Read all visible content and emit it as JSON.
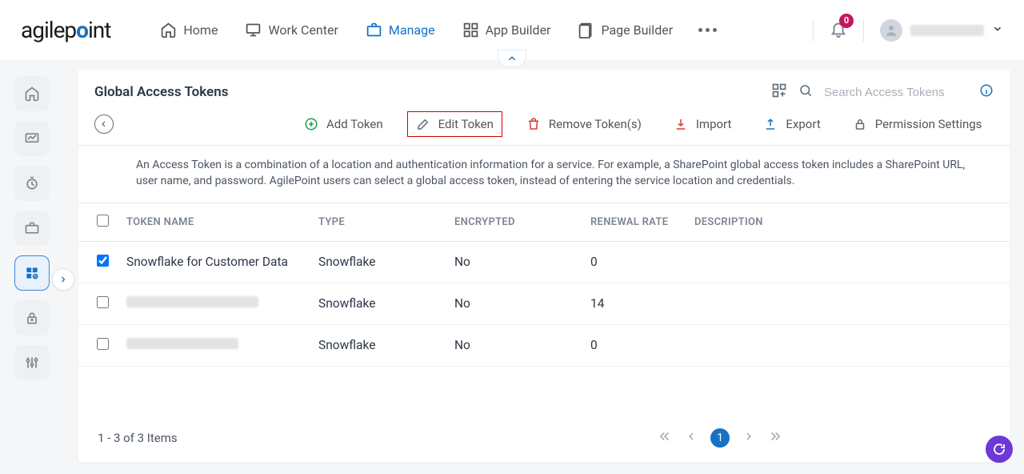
{
  "header": {
    "logo_a": "agilep",
    "logo_dot": "o",
    "logo_b": "int",
    "nav": {
      "home": "Home",
      "work_center": "Work Center",
      "manage": "Manage",
      "app_builder": "App Builder",
      "page_builder": "Page Builder"
    },
    "notif_badge": "0"
  },
  "page": {
    "title": "Global Access Tokens",
    "search_placeholder": "Search Access Tokens",
    "description": "An Access Token is a combination of a location and authentication information for a service. For example, a SharePoint global access token includes a SharePoint URL, user name, and password. AgilePoint users can select a global access token, instead of entering the service location and credentials."
  },
  "toolbar": {
    "add": "Add Token",
    "edit": "Edit Token",
    "remove": "Remove Token(s)",
    "import": "Import",
    "export": "Export",
    "permission": "Permission Settings"
  },
  "cols": {
    "name": "TOKEN NAME",
    "type": "TYPE",
    "encrypted": "ENCRYPTED",
    "renewal": "RENEWAL RATE",
    "description": "DESCRIPTION"
  },
  "rows": [
    {
      "checked": true,
      "name": "Snowflake for Customer Data",
      "type": "Snowflake",
      "encrypted": "No",
      "renewal": "0",
      "description": "",
      "redacted": false
    },
    {
      "checked": false,
      "name": "",
      "type": "Snowflake",
      "encrypted": "No",
      "renewal": "14",
      "description": "",
      "redacted": true
    },
    {
      "checked": false,
      "name": "",
      "type": "Snowflake",
      "encrypted": "No",
      "renewal": "0",
      "description": "",
      "redacted": true
    }
  ],
  "footer": {
    "range": "1 - 3 of 3 Items",
    "page": "1"
  }
}
